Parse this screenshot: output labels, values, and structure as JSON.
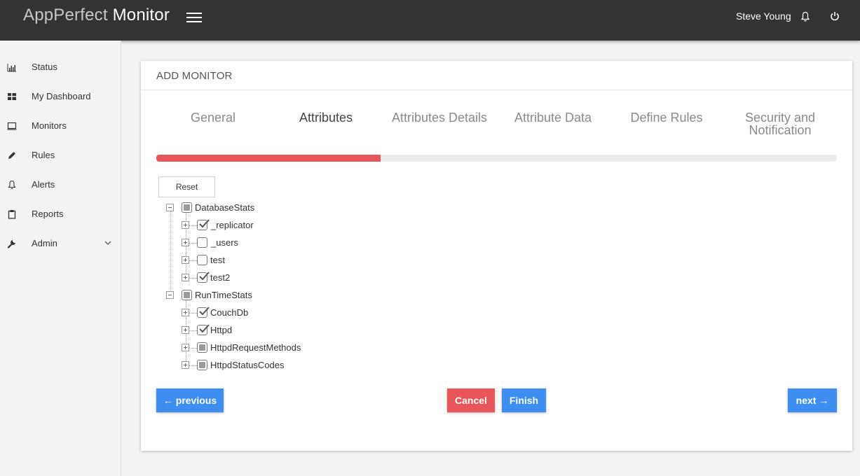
{
  "app": {
    "brand_light": "AppPerfect",
    "brand_bold": "Monitor",
    "user": "Steve Young"
  },
  "sidebar": {
    "items": [
      {
        "label": "Status",
        "icon": "bar-chart-icon"
      },
      {
        "label": "My Dashboard",
        "icon": "dashboard-grid-icon"
      },
      {
        "label": "Monitors",
        "icon": "monitor-icon"
      },
      {
        "label": "Rules",
        "icon": "pencil-icon"
      },
      {
        "label": "Alerts",
        "icon": "bell-icon"
      },
      {
        "label": "Reports",
        "icon": "clipboard-icon"
      },
      {
        "label": "Admin",
        "icon": "wrench-icon"
      }
    ]
  },
  "card": {
    "title": "ADD MONITOR",
    "steps": [
      "General",
      "Attributes",
      "Attributes Details",
      "Attribute Data",
      "Define Rules",
      "Security and Notification"
    ],
    "active_step": "Attributes",
    "progress_fraction": 0.33
  },
  "tree": {
    "reset_label": "Reset",
    "groups": [
      {
        "label": "DatabaseStats",
        "state": "partial",
        "children": [
          {
            "label": "_replicator",
            "state": "checked"
          },
          {
            "label": "_users",
            "state": "unchecked"
          },
          {
            "label": "test",
            "state": "unchecked"
          },
          {
            "label": "test2",
            "state": "checked"
          }
        ]
      },
      {
        "label": "RunTimeStats",
        "state": "partial",
        "children": [
          {
            "label": "CouchDb",
            "state": "checked"
          },
          {
            "label": "Httpd",
            "state": "checked"
          },
          {
            "label": "HttpdRequestMethods",
            "state": "partial"
          },
          {
            "label": "HttpdStatusCodes",
            "state": "partial"
          }
        ]
      }
    ]
  },
  "buttons": {
    "previous": "← previous",
    "cancel": "Cancel",
    "finish": "Finish",
    "next": "next →"
  },
  "colors": {
    "topbar": "#333333",
    "accent_blue": "#3d8ef0",
    "accent_red": "#e8565a"
  }
}
